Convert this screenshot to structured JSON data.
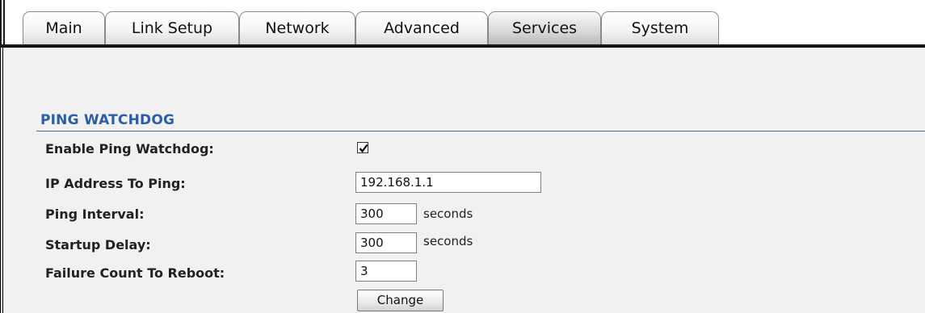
{
  "tabs": [
    {
      "label": "Main",
      "active": false
    },
    {
      "label": "Link Setup",
      "active": false
    },
    {
      "label": "Network",
      "active": false
    },
    {
      "label": "Advanced",
      "active": false
    },
    {
      "label": "Services",
      "active": true
    },
    {
      "label": "System",
      "active": false
    }
  ],
  "section": {
    "title": "PING WATCHDOG"
  },
  "form": {
    "enable_label": "Enable Ping Watchdog:",
    "enable_checked": true,
    "ip_label": "IP Address To Ping:",
    "ip_value": "192.168.1.1",
    "interval_label": "Ping Interval:",
    "interval_value": "300",
    "interval_unit": "seconds",
    "startup_label": "Startup Delay:",
    "startup_value": "300",
    "startup_unit": "seconds",
    "failure_label": "Failure Count To Reboot:",
    "failure_value": "3",
    "change_label": "Change"
  },
  "colors": {
    "section_title": "#2a5ea8",
    "frame_background": "#f1f1f1"
  }
}
